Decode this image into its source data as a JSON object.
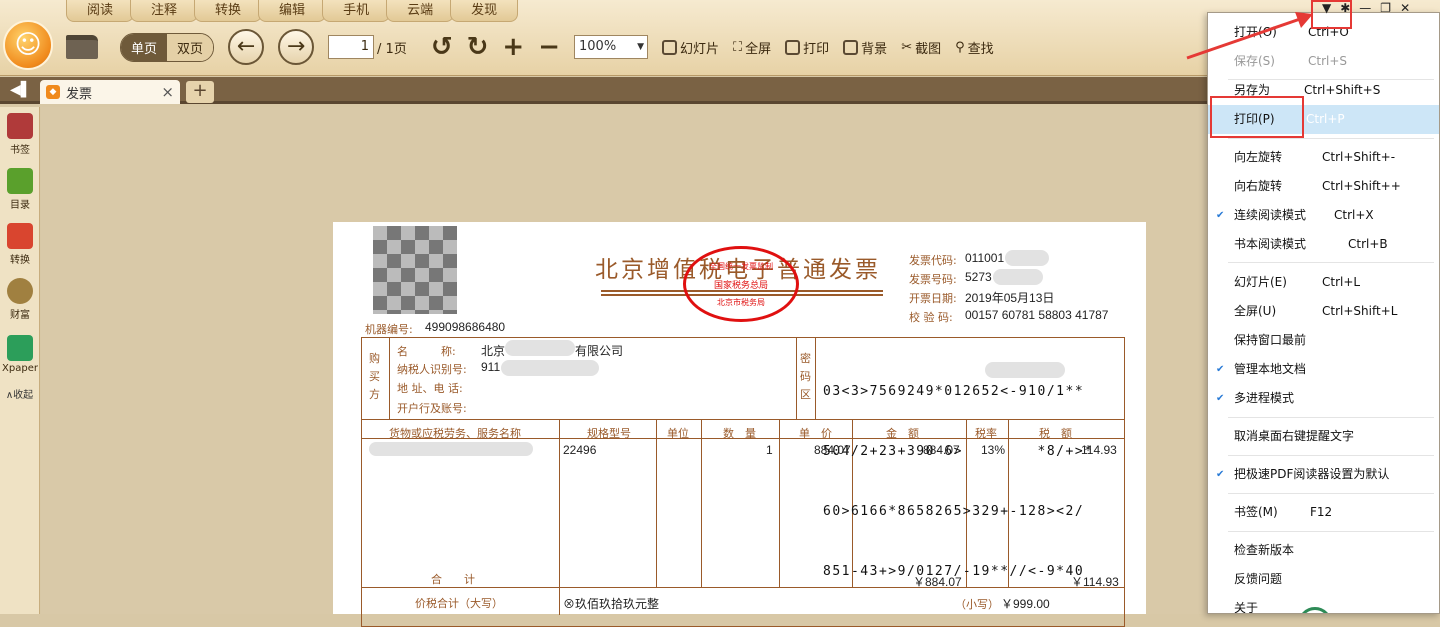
{
  "menu_tabs": [
    "阅读",
    "注释",
    "转换",
    "编辑",
    "手机",
    "云端",
    "发现"
  ],
  "toolbar": {
    "single_page": "单页",
    "double_page": "双页",
    "page_current": "1",
    "page_total": "/ 1页",
    "zoom": "100%",
    "slideshow": "幻灯片",
    "fullscreen": "全屏",
    "print": "打印",
    "background": "背景",
    "screenshot": "截图",
    "find": "查找"
  },
  "window_controls": [
    "▼",
    "✱",
    "—",
    "❐",
    "✕"
  ],
  "tab": {
    "label": "发票",
    "close": "×",
    "add": "+"
  },
  "sidebar": {
    "items": [
      {
        "label": "书签",
        "icon": "bookmark-icon",
        "color": "#b03a3a"
      },
      {
        "label": "目录",
        "icon": "toc-icon",
        "color": "#5aa02c"
      },
      {
        "label": "转换",
        "icon": "convert-icon",
        "color": "#d9452f"
      },
      {
        "label": "财富",
        "icon": "wealth-icon",
        "color": "#a08040"
      },
      {
        "label": "Xpaper",
        "icon": "xpaper-icon",
        "color": "#2c9e5a"
      }
    ],
    "collapse": "∧收起"
  },
  "invoice": {
    "title": "北京增值税电子普通发票",
    "stamp_top": "全国统一发票监制",
    "stamp_mid": "国家税务总局",
    "stamp_bottom": "北京市税务局",
    "code_label": "发票代码:",
    "code_value": "011001",
    "number_label": "发票号码:",
    "number_value": "5273",
    "date_label": "开票日期:",
    "date_value": "2019年05月13日",
    "check_label": "校 验 码:",
    "check_value": "00157 60781 58803 41787",
    "machine_label": "机器编号:",
    "machine_value": "499098686480",
    "buyer_side": "购买方",
    "buyer_name_label": "名　　　称:",
    "buyer_name_value": "北京",
    "buyer_name_suffix": "有限公司",
    "buyer_tax_label": "纳税人识别号:",
    "buyer_tax_value": "911",
    "buyer_addr_label": "地 址、电 话:",
    "buyer_bank_label": "开户行及账号:",
    "cipher_side": "密码区",
    "cipher_lines": [
      "03<3>7569249*012652<-910/1**",
      "504/2+23+390-6>        *8/+>*",
      "60>6166*8658265>329+-128><2/",
      "851-43+>9/0127/-19**//<-9*40"
    ],
    "col_goods": "货物或应税劳务、服务名称",
    "col_spec": "规格型号",
    "col_unit": "单位",
    "col_qty": "数　量",
    "col_price": "单　价",
    "col_amount": "金　额",
    "col_rate": "税率",
    "col_tax": "税　额",
    "row_spec": "22496",
    "row_qty": "1",
    "row_price": "884.07",
    "row_amount": "884.07",
    "row_rate": "13%",
    "row_tax": "114.93",
    "total_label": "合　　计",
    "total_amount": "￥884.07",
    "total_tax": "￥114.93",
    "grand_label": "价税合计（大写）",
    "grand_words": "⊗玖佰玖拾玖元整",
    "grand_small_label": "（小写）",
    "grand_small_value": "￥999.00"
  },
  "context_menu": {
    "items": [
      {
        "label": "打开(O)",
        "shortcut": "Ctrl+O",
        "disabled": false,
        "checked": false
      },
      {
        "label": "保存(S)",
        "shortcut": "Ctrl+S",
        "disabled": true,
        "checked": false
      },
      {
        "label": "另存为",
        "shortcut": "Ctrl+Shift+S",
        "disabled": false,
        "checked": false
      },
      {
        "label": "打印(P)",
        "shortcut": "Ctrl+P",
        "disabled": false,
        "checked": false,
        "highlighted": true
      },
      {
        "label": "向左旋转",
        "shortcut": "Ctrl+Shift+-",
        "disabled": false,
        "checked": false
      },
      {
        "label": "向右旋转",
        "shortcut": "Ctrl+Shift++",
        "disabled": false,
        "checked": false
      },
      {
        "label": "连续阅读模式",
        "shortcut": "Ctrl+X",
        "disabled": false,
        "checked": true
      },
      {
        "label": "书本阅读模式",
        "shortcut": "Ctrl+B",
        "disabled": false,
        "checked": false
      },
      {
        "label": "幻灯片(E)",
        "shortcut": "Ctrl+L",
        "disabled": false,
        "checked": false
      },
      {
        "label": "全屏(U)",
        "shortcut": "Ctrl+Shift+L",
        "disabled": false,
        "checked": false
      },
      {
        "label": "保持窗口最前",
        "shortcut": "",
        "disabled": false,
        "checked": false
      },
      {
        "label": "管理本地文档",
        "shortcut": "",
        "disabled": false,
        "checked": true
      },
      {
        "label": "多进程模式",
        "shortcut": "",
        "disabled": false,
        "checked": true
      },
      {
        "label": "取消桌面右键提醒文字",
        "shortcut": "",
        "disabled": false,
        "checked": false
      },
      {
        "label": "把极速PDF阅读器设置为默认",
        "shortcut": "",
        "disabled": false,
        "checked": true
      },
      {
        "label": "书签(M)",
        "shortcut": "F12",
        "disabled": false,
        "checked": false
      },
      {
        "label": "检查新版本",
        "shortcut": "",
        "disabled": false,
        "checked": false
      },
      {
        "label": "反馈问题",
        "shortcut": "",
        "disabled": false,
        "checked": false
      },
      {
        "label": "关于",
        "shortcut": "",
        "disabled": false,
        "checked": false
      }
    ]
  }
}
